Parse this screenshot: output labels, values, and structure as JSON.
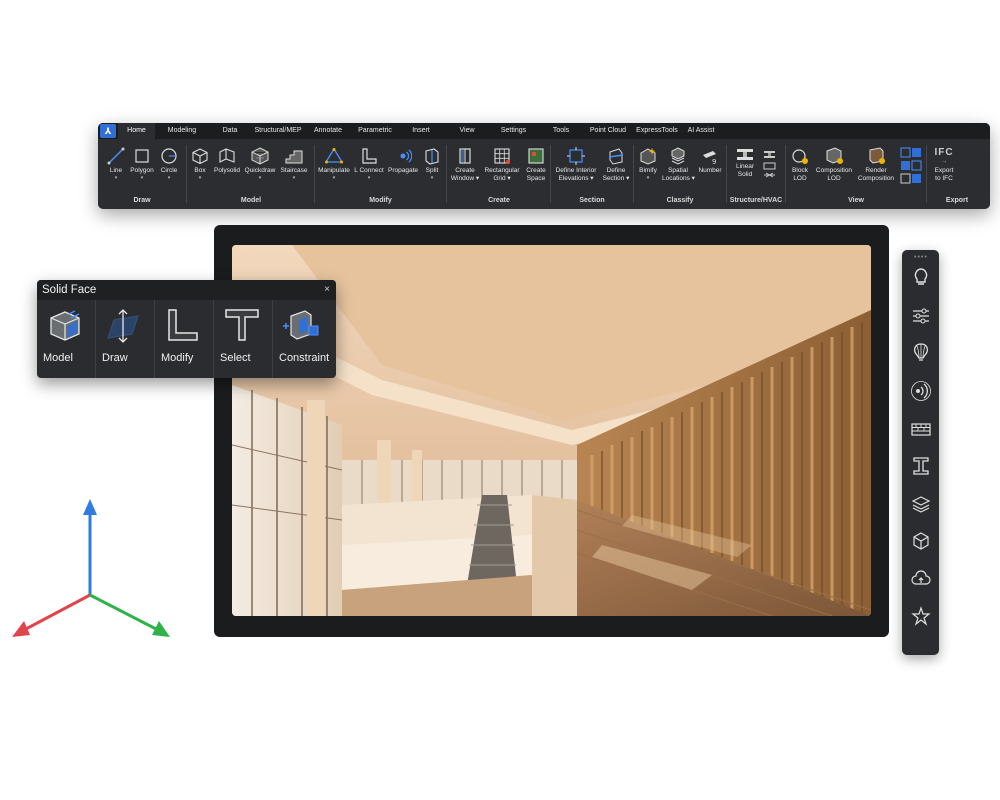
{
  "ribbon": {
    "app_logo": "⅄",
    "tabs": [
      {
        "label": "Home"
      },
      {
        "label": "Modeling"
      },
      {
        "label": "Data"
      },
      {
        "label": "Structural/MEP"
      },
      {
        "label": "Annotate"
      },
      {
        "label": "Parametric"
      },
      {
        "label": "Insert"
      },
      {
        "label": "View"
      },
      {
        "label": "Settings"
      },
      {
        "label": "Tools"
      },
      {
        "label": "Point Cloud"
      },
      {
        "label": "ExpressTools"
      },
      {
        "label": "AI Assist"
      }
    ],
    "groups": {
      "draw": {
        "label": "Draw",
        "line": "Line",
        "polygon": "Polygon",
        "circle": "Circle"
      },
      "model": {
        "label": "Model",
        "box": "Box",
        "polysolid": "Polysolid",
        "quickdraw": "Quickdraw",
        "staircase": "Staircase"
      },
      "modify": {
        "label": "Modify",
        "manipulate": "Manipulate",
        "lconnect": "L Connect",
        "propagate": "Propagate",
        "split": "Split"
      },
      "create": {
        "label": "Create",
        "create_window_1": "Create",
        "create_window_2": "Window",
        "rect_grid_1": "Rectangular",
        "rect_grid_2": "Grid",
        "create_space_1": "Create",
        "create_space_2": "Space"
      },
      "section": {
        "label": "Section",
        "define_interior_1": "Define Interior",
        "define_interior_2": "Elevations",
        "define_section_1": "Define",
        "define_section_2": "Section"
      },
      "classify": {
        "label": "Classify",
        "bimify": "Bimify",
        "spatial_1": "Spatial",
        "spatial_2": "Locations",
        "number": "Number"
      },
      "structure": {
        "label": "Structure/HVAC",
        "linear_1": "Linear",
        "linear_2": "Solid"
      },
      "view": {
        "label": "View",
        "block_1": "Block",
        "block_2": "LOD",
        "composition_1": "Composition",
        "composition_2": "LOD",
        "render_1": "Render",
        "render_2": "Composition"
      },
      "export": {
        "label": "Export",
        "ifc_icon_text": "IFC",
        "export_1": "Export",
        "export_2": "to IFC"
      }
    }
  },
  "solid_face": {
    "title": "Solid Face",
    "close": "×",
    "items": [
      {
        "label": "Model"
      },
      {
        "label": "Draw"
      },
      {
        "label": "Modify"
      },
      {
        "label": "Select"
      },
      {
        "label": "Constraint"
      }
    ]
  },
  "right_panel": {
    "grip": "••••",
    "icons": [
      "lightbulb-icon",
      "sliders-icon",
      "balloon-icon",
      "sound-waves-icon",
      "wall-icon",
      "i-beam-icon",
      "layers-icon",
      "cube-icon",
      "cloud-upload-icon",
      "star-icon"
    ]
  },
  "colors": {
    "accent": "#2f6fd6",
    "ribbon_bg": "#2b2d30",
    "axis_x": "#e0454b",
    "axis_y": "#2fb24a",
    "axis_z": "#2f7be0"
  }
}
